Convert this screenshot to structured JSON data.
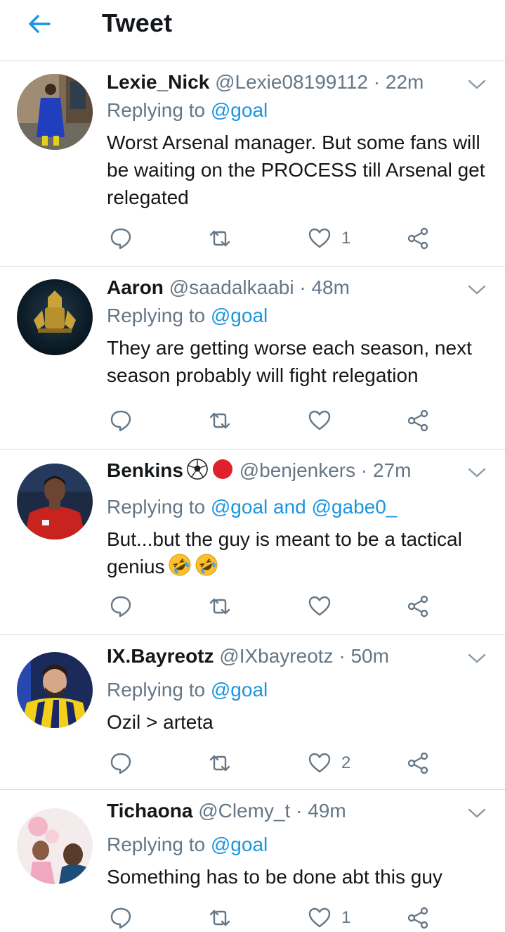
{
  "header": {
    "title": "Tweet"
  },
  "colors": {
    "accent": "#1b95e0",
    "muted": "#657786",
    "text": "#14171a",
    "divider": "#d6dbe0"
  },
  "replies": [
    {
      "name": "Lexie_Nick",
      "handle": "@Lexie08199112",
      "time": "22m",
      "replying_prefix": "Replying to",
      "mentions": "@goal",
      "text": "Worst Arsenal manager. But some fans will be waiting on the PROCESS till Arsenal get relegated",
      "likes": "1"
    },
    {
      "name": "Aaron",
      "handle": "@saadalkaabi",
      "time": "48m",
      "replying_prefix": "Replying to",
      "mentions": "@goal",
      "text": "They are getting worse each season, next season probably will fight relegation",
      "likes": ""
    },
    {
      "name": "Benkins",
      "name_emojis": [
        "soccer-ball",
        "red-circle"
      ],
      "handle": "@benjenkers",
      "time": "27m",
      "replying_prefix": "Replying to",
      "mentions": "@goal and @gabe0_",
      "text": "But...but the guy is meant to be a tactical genius",
      "text_emojis": [
        "rolling-on-floor-laughing",
        "rolling-on-floor-laughing"
      ],
      "likes": ""
    },
    {
      "name": "IX.Bayreotz",
      "handle": "@IXbayreotz",
      "time": "50m",
      "replying_prefix": "Replying to",
      "mentions": "@goal",
      "text": "Ozil > arteta",
      "likes": "2"
    },
    {
      "name": "Tichaona",
      "handle": "@Clemy_t",
      "time": "49m",
      "replying_prefix": "Replying to",
      "mentions": "@goal",
      "text": "Something has to be done abt this guy",
      "likes": "1"
    }
  ]
}
